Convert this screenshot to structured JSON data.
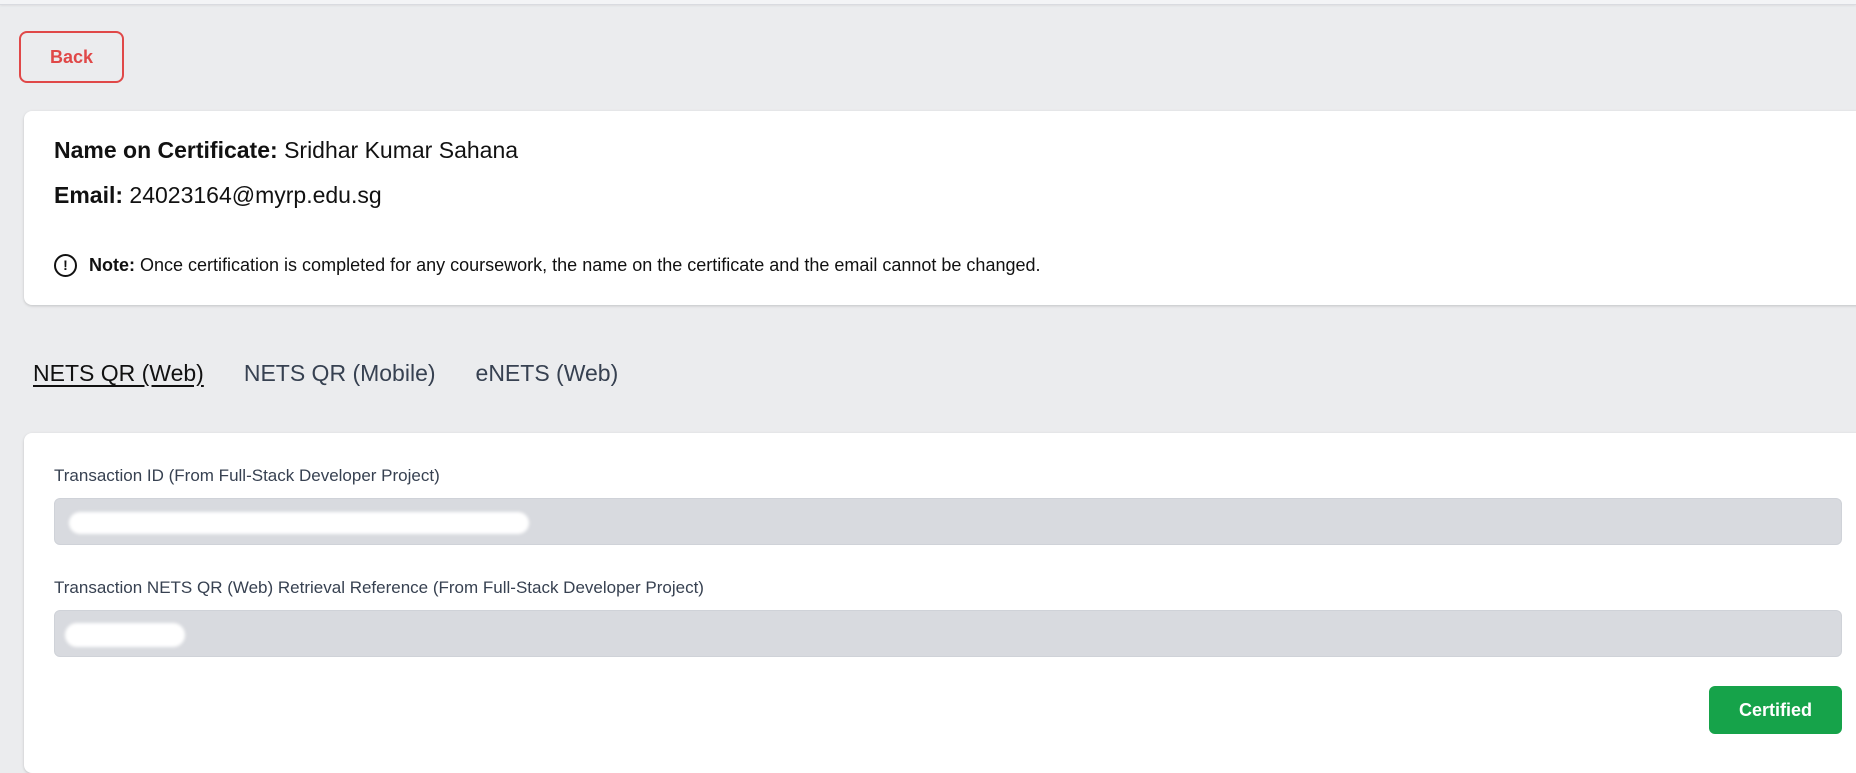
{
  "header": {
    "back_label": "Back"
  },
  "profile": {
    "name_label": "Name on Certificate:",
    "name_value": "Sridhar Kumar Sahana",
    "email_label": "Email:",
    "email_value": "24023164@myrp.edu.sg",
    "note_icon_glyph": "!",
    "note_label": "Note:",
    "note_text": "Once certification is completed for any coursework, the name on the certificate and the email cannot be changed."
  },
  "tabs": [
    {
      "label": "NETS QR (Web)",
      "active": true
    },
    {
      "label": "NETS QR (Mobile)",
      "active": false
    },
    {
      "label": "eNETS (Web)",
      "active": false
    }
  ],
  "form": {
    "transaction_id_label": "Transaction ID (From Full-Stack Developer Project)",
    "retrieval_ref_label": "Transaction NETS QR (Web) Retrieval Reference (From Full-Stack Developer Project)",
    "submit_label": "Certified"
  },
  "colors": {
    "back_accent": "#e04848",
    "certified_green": "#16a34a",
    "page_bg": "#ebecee",
    "input_bg": "#d8dadf"
  },
  "icons": {
    "note": "exclamation-circle-icon"
  }
}
